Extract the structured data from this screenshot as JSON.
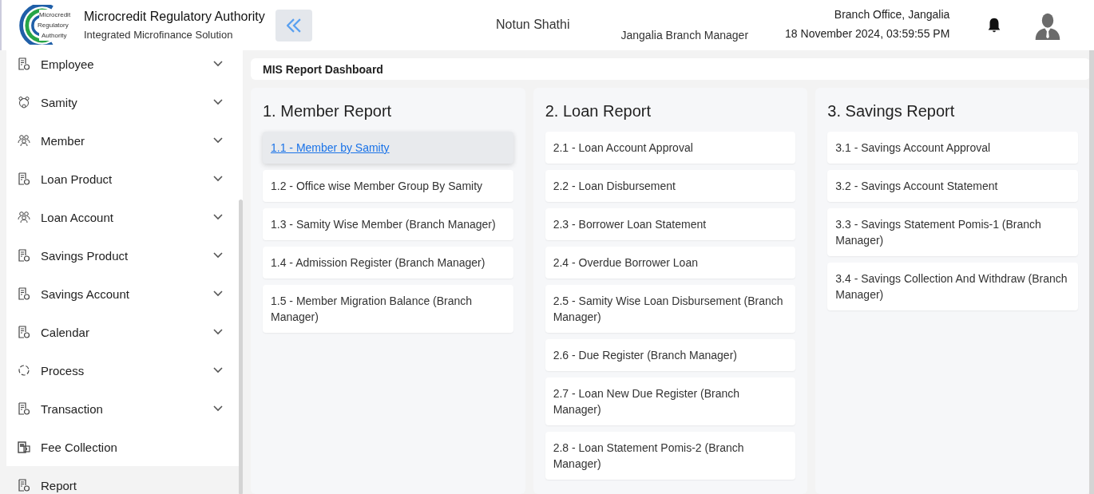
{
  "header": {
    "logo_text": [
      "Microcredit",
      "Regulatory",
      "Authority"
    ],
    "title": "Microcredit Regulatory Authority",
    "subtitle": "Integrated Microfinance Solution",
    "project": "Notun Shathi",
    "role": "Jangalia Branch Manager",
    "office": "Branch Office, Jangalia",
    "datetime": "18 November 2024, 03:59:55 PM"
  },
  "sidebar": {
    "items": [
      {
        "label": "Employee",
        "kind": "doc-person",
        "expandable": true,
        "selected": false
      },
      {
        "label": "Samity",
        "kind": "group",
        "expandable": true,
        "selected": false
      },
      {
        "label": "Member",
        "kind": "people",
        "expandable": true,
        "selected": false
      },
      {
        "label": "Loan Product",
        "kind": "doc",
        "expandable": true,
        "selected": false
      },
      {
        "label": "Loan Account",
        "kind": "people",
        "expandable": true,
        "selected": false
      },
      {
        "label": "Savings Product",
        "kind": "doc",
        "expandable": true,
        "selected": false
      },
      {
        "label": "Savings Account",
        "kind": "doc",
        "expandable": true,
        "selected": false
      },
      {
        "label": "Calendar",
        "kind": "doc",
        "expandable": true,
        "selected": false
      },
      {
        "label": "Process",
        "kind": "cycle",
        "expandable": true,
        "selected": false
      },
      {
        "label": "Transaction",
        "kind": "doc",
        "expandable": true,
        "selected": false
      },
      {
        "label": "Fee Collection",
        "kind": "fee",
        "expandable": false,
        "selected": false
      },
      {
        "label": "Report",
        "kind": "doc",
        "expandable": false,
        "selected": true
      }
    ]
  },
  "page_title": "MIS Report Dashboard",
  "sections": [
    {
      "title": "1. Member Report",
      "items": [
        {
          "label": "1.1 - Member by Samity",
          "hovered": true
        },
        {
          "label": "1.2 - Office wise Member Group By Samity",
          "hovered": false
        },
        {
          "label": "1.3 - Samity Wise Member (Branch Manager)",
          "hovered": false
        },
        {
          "label": "1.4 - Admission Register (Branch Manager)",
          "hovered": false
        },
        {
          "label": "1.5 - Member Migration Balance (Branch Manager)",
          "hovered": false
        }
      ]
    },
    {
      "title": "2. Loan Report",
      "items": [
        {
          "label": "2.1 - Loan Account Approval",
          "hovered": false
        },
        {
          "label": "2.2 - Loan Disbursement",
          "hovered": false
        },
        {
          "label": "2.3 - Borrower Loan Statement",
          "hovered": false
        },
        {
          "label": "2.4 - Overdue Borrower Loan",
          "hovered": false
        },
        {
          "label": "2.5 - Samity Wise Loan Disbursement (Branch Manager)",
          "hovered": false
        },
        {
          "label": "2.6 - Due Register (Branch Manager)",
          "hovered": false
        },
        {
          "label": "2.7 - Loan New Due Register (Branch Manager)",
          "hovered": false
        },
        {
          "label": "2.8 - Loan Statement Pomis-2 (Branch Manager)",
          "hovered": false
        }
      ]
    },
    {
      "title": "3. Savings Report",
      "items": [
        {
          "label": "3.1 - Savings Account Approval",
          "hovered": false
        },
        {
          "label": "3.2 - Savings Account Statement",
          "hovered": false
        },
        {
          "label": "3.3 - Savings Statement Pomis-1 (Branch Manager)",
          "hovered": false
        },
        {
          "label": "3.4 - Savings Collection And Withdraw (Branch Manager)",
          "hovered": false
        }
      ]
    }
  ]
}
